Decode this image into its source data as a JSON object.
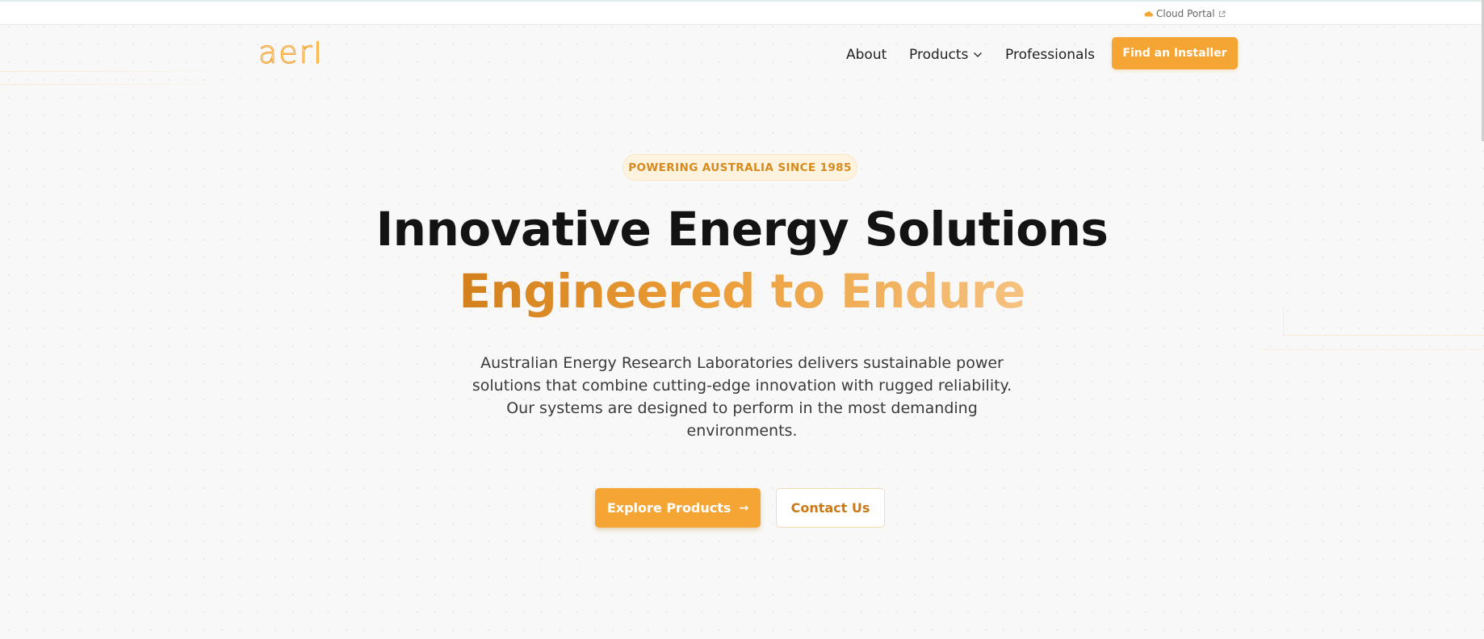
{
  "topbar": {
    "cloud_portal_label": "Cloud Portal"
  },
  "header": {
    "logo_text": "aerl",
    "nav": {
      "about": "About",
      "products": "Products",
      "professionals": "Professionals"
    },
    "cta_label": "Find an Installer"
  },
  "hero": {
    "badge": "POWERING AUSTRALIA SINCE 1985",
    "title_line1": "Innovative Energy Solutions",
    "title_line2": "Engineered to Endure",
    "description": "Australian Energy Research Laboratories delivers sustainable power solutions that combine cutting-edge innovation with rugged reliability. Our systems are designed to perform in the most demanding environments.",
    "primary_button": "Explore Products",
    "primary_arrow": "→",
    "secondary_button": "Contact Us"
  },
  "colors": {
    "accent": "#f4a534",
    "accent_dark": "#d2801c",
    "text": "#131313"
  },
  "icons": {
    "cloud": "cloud-icon",
    "external": "external-link-icon",
    "chevron": "chevron-down-icon"
  }
}
